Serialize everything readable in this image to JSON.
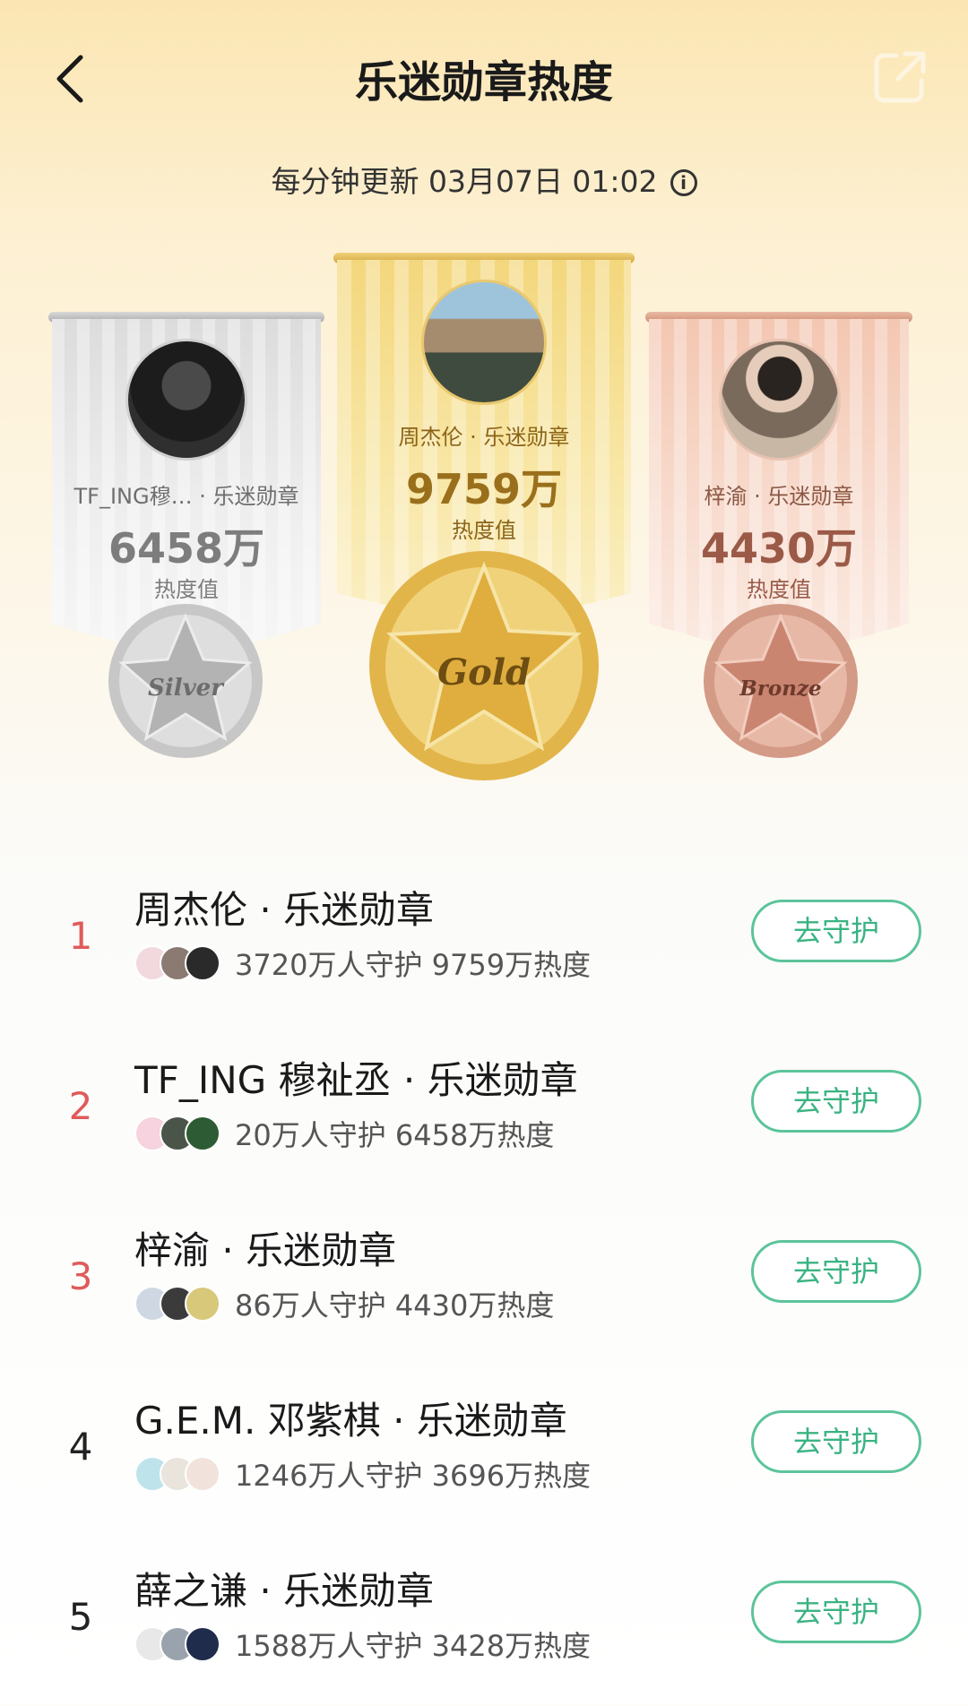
{
  "header": {
    "title": "乐迷勋章热度",
    "update_text": "每分钟更新 03月07日 01:02",
    "info_symbol": "i"
  },
  "podium": {
    "first": {
      "name": "周杰伦 · 乐迷勋章",
      "value": "9759万",
      "unit_label": "热度值",
      "medal_label": "Gold"
    },
    "second": {
      "name": "TF_ING穆… · 乐迷勋章",
      "value": "6458万",
      "unit_label": "热度值",
      "medal_label": "Silver"
    },
    "third": {
      "name": "梓渝 · 乐迷勋章",
      "value": "4430万",
      "unit_label": "热度值",
      "medal_label": "Bronze"
    }
  },
  "ranking": [
    {
      "rank": "1",
      "name": "周杰伦 · 乐迷勋章",
      "stats": "3720万人守护  9759万热度",
      "button": "去守护"
    },
    {
      "rank": "2",
      "name": "TF_ING 穆祉丞 · 乐迷勋章",
      "stats": "20万人守护  6458万热度",
      "button": "去守护"
    },
    {
      "rank": "3",
      "name": "梓渝 · 乐迷勋章",
      "stats": "86万人守护  4430万热度",
      "button": "去守护"
    },
    {
      "rank": "4",
      "name": "G.E.M. 邓紫棋 · 乐迷勋章",
      "stats": "1246万人守护  3696万热度",
      "button": "去守护"
    },
    {
      "rank": "5",
      "name": "薛之谦 · 乐迷勋章",
      "stats": "1588万人守护  3428万热度",
      "button": "去守护"
    }
  ],
  "colors": {
    "accent_green": "#3ab382",
    "rank_red": "#e05a5a",
    "gold": "#b8862a",
    "silver": "#7d7d7d",
    "bronze": "#9a5a47"
  },
  "icons": {
    "back": "chevron-left-icon",
    "share": "share-icon",
    "info": "info-icon"
  }
}
